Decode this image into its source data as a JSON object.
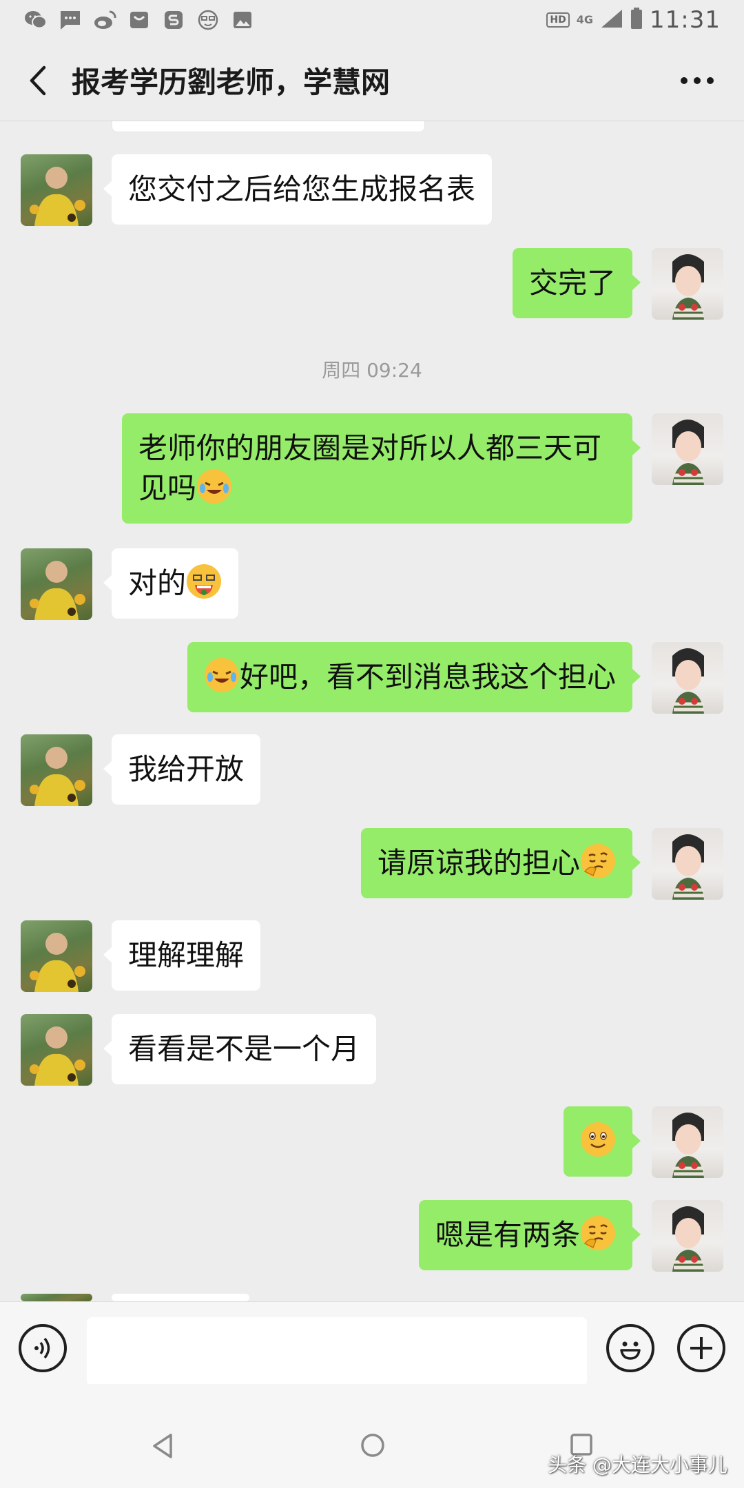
{
  "status_bar": {
    "time": "11:31",
    "hd": "HD",
    "network": "4G",
    "icons": [
      "wechat-icon",
      "message-icon",
      "weibo-icon",
      "mail-icon",
      "app-s-icon",
      "face-glasses-icon",
      "image-icon"
    ]
  },
  "header": {
    "title": "报考学历劉老师，学慧网"
  },
  "timestamp": "周四 09:24",
  "messages": [
    {
      "sender": "teacher",
      "text": "您交付之后给您生成报名表"
    },
    {
      "sender": "me",
      "text": "交完了"
    },
    {
      "sender": "me",
      "text": "老师你的朋友圈是对所以人都三天可见吗",
      "emoji": "laughing-crying-emoji"
    },
    {
      "sender": "teacher",
      "text": "对的",
      "emoji": "grinning-emoji"
    },
    {
      "sender": "me",
      "text": "好吧，看不到消息我这个担心",
      "emoji": "laughing-crying-emoji"
    },
    {
      "sender": "teacher",
      "text": "我给开放"
    },
    {
      "sender": "me",
      "text": "请原谅我的担心",
      "emoji": "thinking-emoji"
    },
    {
      "sender": "teacher",
      "text": "理解理解"
    },
    {
      "sender": "teacher",
      "text": "看看是不是一个月"
    },
    {
      "sender": "me",
      "text": "",
      "emoji": "smile-emoji"
    },
    {
      "sender": "me",
      "text": "嗯是有两条",
      "emoji": "thinking-emoji"
    }
  ],
  "input": {
    "placeholder": ""
  },
  "watermark": "头条 @大连大小事儿",
  "colors": {
    "background": "#ededed",
    "my_bubble": "#95ec69",
    "their_bubble": "#ffffff"
  }
}
